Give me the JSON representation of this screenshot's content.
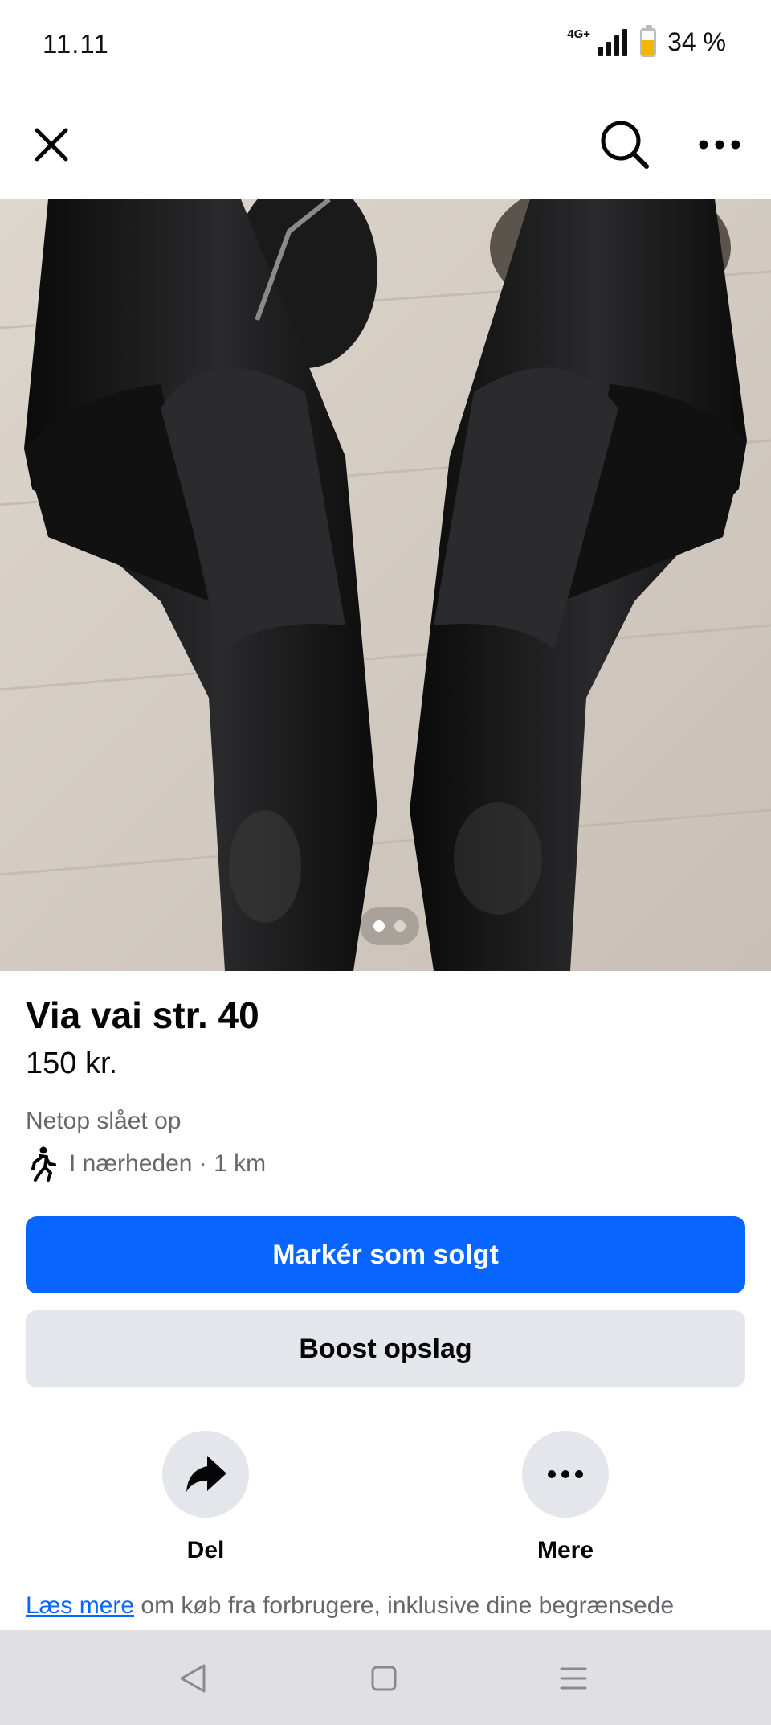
{
  "status_bar": {
    "time": "11.11",
    "network": "4G+",
    "battery_percent": "34 %",
    "battery_level": 0.34
  },
  "top_nav": {
    "close_icon": "close-icon",
    "search_icon": "search-icon",
    "more_icon": "more-horizontal-icon"
  },
  "listing": {
    "photo_description_icon": "photo",
    "photo_count": 2,
    "photo_current": 1,
    "title": "Via vai str. 40",
    "price": "150 kr.",
    "posted": "Netop slået op",
    "location": "I nærheden · 1 km"
  },
  "actions": {
    "primary_label": "Markér som solgt",
    "secondary_label": "Boost opslag",
    "share_label": "Del",
    "more_label": "Mere"
  },
  "info": {
    "link_text": "Læs mere",
    "text": " om køb fra forbrugere, inklusive dine begrænsede"
  },
  "colors": {
    "primary": "#0866ff",
    "secondary_bg": "#e4e6eb",
    "muted_text": "#65676b"
  }
}
